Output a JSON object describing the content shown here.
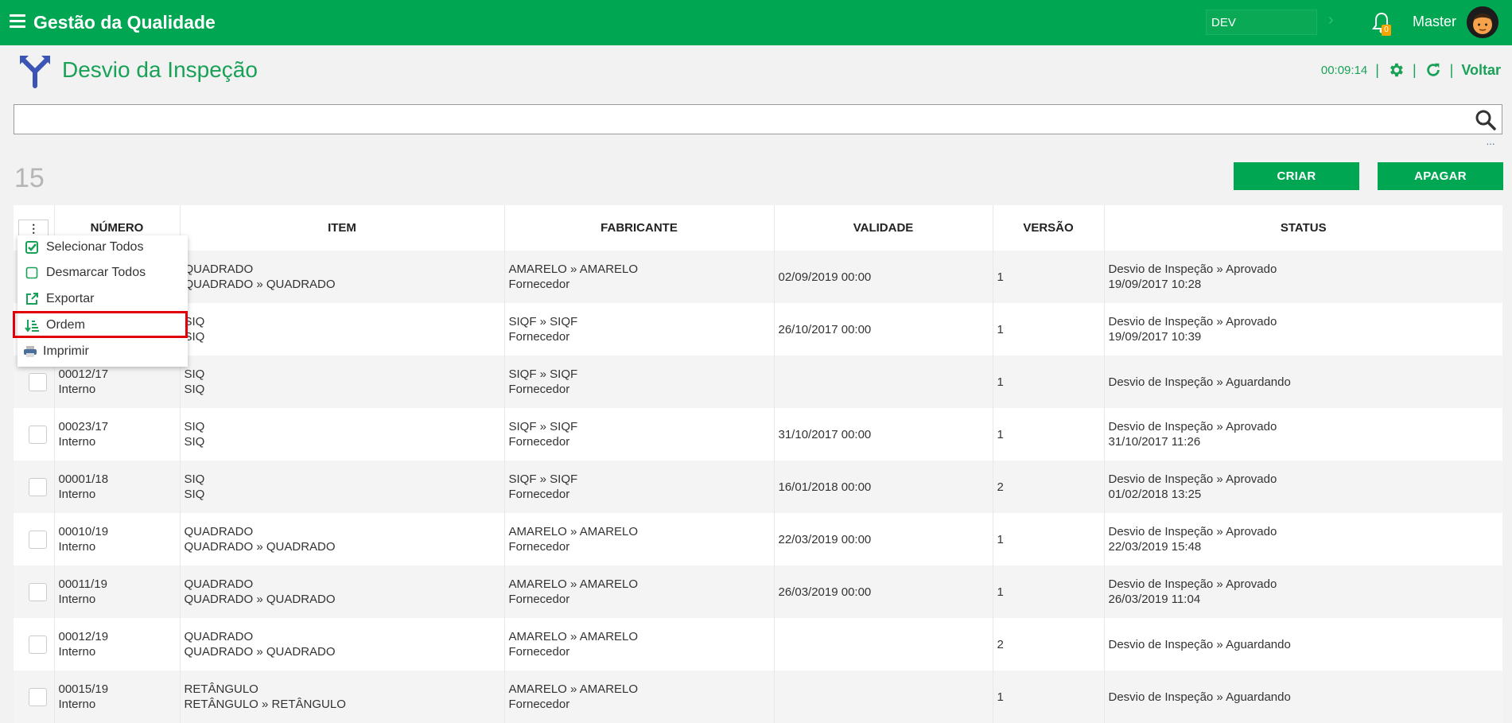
{
  "app": {
    "title": "Gestão da Qualidade",
    "env": "DEV",
    "user": "Master",
    "notifications": "0"
  },
  "page": {
    "title": "Desvio da Inspeção",
    "timer": "00:09:14",
    "back_label": "Voltar",
    "sep": "|"
  },
  "search": {
    "placeholder": "",
    "more": "···"
  },
  "list": {
    "count": "15",
    "create_label": "CRIAR",
    "delete_label": "APAGAR"
  },
  "table": {
    "columns": [
      "NÚMERO",
      "ITEM",
      "FABRICANTE",
      "VALIDADE",
      "VERSÃO",
      "STATUS"
    ],
    "rows": [
      {
        "num1": "",
        "num2": "",
        "item1": "QUADRADO",
        "item2": "QUADRADO » QUADRADO",
        "fab1": "AMARELO » AMARELO",
        "fab2": "Fornecedor",
        "validade": "02/09/2019 00:00",
        "versao": "1",
        "status1": "Desvio de Inspeção » Aprovado",
        "status2": "19/09/2017 10:28"
      },
      {
        "num1": "",
        "num2": "",
        "item1": "SIQ",
        "item2": "SIQ",
        "fab1": "SIQF » SIQF",
        "fab2": "Fornecedor",
        "validade": "26/10/2017 00:00",
        "versao": "1",
        "status1": "Desvio de Inspeção » Aprovado",
        "status2": "19/09/2017 10:39"
      },
      {
        "num1": "00012/17",
        "num2": "Interno",
        "item1": "SIQ",
        "item2": "SIQ",
        "fab1": "SIQF » SIQF",
        "fab2": "Fornecedor",
        "validade": "",
        "versao": "1",
        "status1": "Desvio de Inspeção » Aguardando",
        "status2": ""
      },
      {
        "num1": "00023/17",
        "num2": "Interno",
        "item1": "SIQ",
        "item2": "SIQ",
        "fab1": "SIQF » SIQF",
        "fab2": "Fornecedor",
        "validade": "31/10/2017 00:00",
        "versao": "1",
        "status1": "Desvio de Inspeção » Aprovado",
        "status2": "31/10/2017 11:26"
      },
      {
        "num1": "00001/18",
        "num2": "Interno",
        "item1": "SIQ",
        "item2": "SIQ",
        "fab1": "SIQF » SIQF",
        "fab2": "Fornecedor",
        "validade": "16/01/2018 00:00",
        "versao": "2",
        "status1": "Desvio de Inspeção » Aprovado",
        "status2": "01/02/2018 13:25"
      },
      {
        "num1": "00010/19",
        "num2": "Interno",
        "item1": "QUADRADO",
        "item2": "QUADRADO » QUADRADO",
        "fab1": "AMARELO » AMARELO",
        "fab2": "Fornecedor",
        "validade": "22/03/2019 00:00",
        "versao": "1",
        "status1": "Desvio de Inspeção » Aprovado",
        "status2": "22/03/2019 15:48"
      },
      {
        "num1": "00011/19",
        "num2": "Interno",
        "item1": "QUADRADO",
        "item2": "QUADRADO » QUADRADO",
        "fab1": "AMARELO » AMARELO",
        "fab2": "Fornecedor",
        "validade": "26/03/2019 00:00",
        "versao": "1",
        "status1": "Desvio de Inspeção » Aprovado",
        "status2": "26/03/2019 11:04"
      },
      {
        "num1": "00012/19",
        "num2": "Interno",
        "item1": "QUADRADO",
        "item2": "QUADRADO » QUADRADO",
        "fab1": "AMARELO » AMARELO",
        "fab2": "Fornecedor",
        "validade": "",
        "versao": "2",
        "status1": "Desvio de Inspeção » Aguardando",
        "status2": ""
      },
      {
        "num1": "00015/19",
        "num2": "Interno",
        "item1": "RETÂNGULO",
        "item2": "RETÂNGULO » RETÂNGULO",
        "fab1": "AMARELO » AMARELO",
        "fab2": "Fornecedor",
        "validade": "",
        "versao": "1",
        "status1": "Desvio de Inspeção » Aguardando",
        "status2": ""
      }
    ]
  },
  "menu": {
    "select_all": "Selecionar Todos",
    "deselect_all": "Desmarcar Todos",
    "export": "Exportar",
    "order": "Ordem",
    "print": "Imprimir"
  },
  "colors": {
    "brand": "#00a651",
    "title": "#1aa158",
    "highlight": "#e0000a"
  }
}
